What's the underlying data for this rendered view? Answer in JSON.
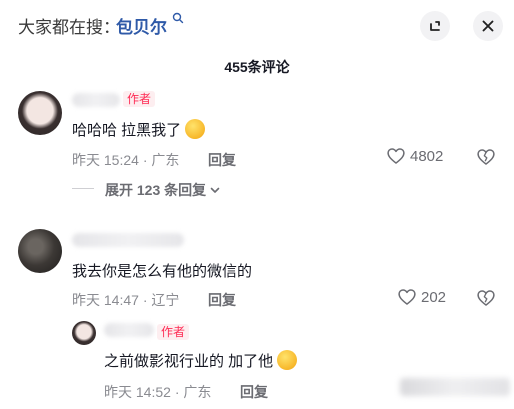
{
  "header": {
    "search_prefix": "大家都在搜：",
    "search_term": "包贝尔"
  },
  "comments_title": "455条评论",
  "comments": [
    {
      "badge": "作者",
      "text": "哈哈哈 拉黑我了",
      "time": "昨天 15:24",
      "location": "广东",
      "reply_label": "回复",
      "likes": "4802",
      "expand_label": "展开 123 条回复"
    },
    {
      "text": "我去你是怎么有他的微信的",
      "time": "昨天 14:47",
      "location": "辽宁",
      "reply_label": "回复",
      "likes": "202"
    }
  ],
  "reply": {
    "badge": "作者",
    "text": "之前做影视行业的 加了他",
    "time": "昨天 14:52",
    "location": "广东",
    "reply_label": "回复"
  },
  "colors": {
    "author_badge": "#fe2c55",
    "search_term": "#2f5aa8"
  },
  "icons": [
    "search-icon",
    "minimize-icon",
    "close-icon",
    "heart-icon",
    "dislike-icon",
    "chevron-down-icon",
    "laugh-cry-emoji"
  ]
}
